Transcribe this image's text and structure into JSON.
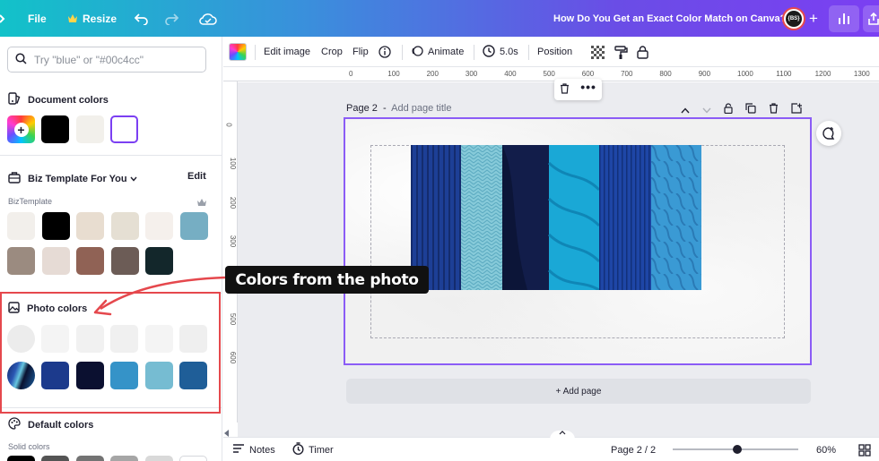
{
  "topbar": {
    "file_label": "File",
    "resize_label": "Resize",
    "doc_title": "How Do You Get an Exact Color Match on Canva?",
    "avatar_text": "{BS}"
  },
  "left_panel": {
    "search_placeholder": "Try \"blue\" or \"#00c4cc\"",
    "document_colors_title": "Document colors",
    "document_colors": [
      "#000000",
      "#f2f0eb",
      "#ffffff"
    ],
    "brand_kit_title": "Biz Template For You",
    "brand_kit_edit": "Edit",
    "brand_palette_label": "BizTemplate",
    "brand_colors_row1": [
      "#f2efeb",
      "#000000",
      "#e8ddd0",
      "#e5dfd3",
      "#f5f0ec",
      "#76aec3"
    ],
    "brand_colors_row2": [
      "#9b8b80",
      "#e6dbd5",
      "#906255",
      "#6c5c56",
      "#13272b"
    ],
    "photo_colors_title": "Photo colors",
    "photo_colors_row1": [
      "#f1f1f1",
      "#f4f4f4",
      "#f1f1f1",
      "#f0f0f0",
      "#f4f4f4",
      "#efefef"
    ],
    "photo_colors_row2": [
      "#1c3a8c",
      "#0b1030",
      "#3593c8",
      "#76bcd2",
      "#1f5e98"
    ],
    "default_colors_title": "Default colors",
    "solid_colors_label": "Solid colors"
  },
  "context_toolbar": {
    "edit_image": "Edit image",
    "crop": "Crop",
    "flip": "Flip",
    "animate": "Animate",
    "duration": "5.0s",
    "position": "Position"
  },
  "rulers": {
    "h_ticks": [
      "0",
      "100",
      "200",
      "300",
      "400",
      "500",
      "600",
      "700",
      "800",
      "900",
      "1000",
      "1100",
      "1200",
      "1300"
    ],
    "v_ticks": [
      "0",
      "100",
      "200",
      "300",
      "400",
      "500",
      "600"
    ]
  },
  "page": {
    "label": "Page 2",
    "title_placeholder": "Add page title",
    "add_page": "+ Add page"
  },
  "bottombar": {
    "notes": "Notes",
    "timer": "Timer",
    "page_indicator": "Page 2 / 2",
    "zoom": "60%",
    "zoom_level": 0.6
  },
  "annotation": {
    "callout": "Colors from the photo",
    "arrow_color": "#e5484d"
  },
  "icons": [
    "home-icon",
    "crown-icon",
    "undo-icon",
    "redo-icon",
    "cloud-sync-icon",
    "chart-icon",
    "share-icon",
    "search-icon",
    "palette-icon",
    "image-icon",
    "info-icon",
    "animate-icon",
    "clock-icon",
    "transparency-icon",
    "paint-roller-icon",
    "lock-icon",
    "trash-icon",
    "more-icon",
    "chevron-up-icon",
    "chevron-down-icon",
    "duplicate-icon",
    "add-page-icon",
    "comment-add-icon",
    "notes-icon",
    "timer-icon"
  ]
}
